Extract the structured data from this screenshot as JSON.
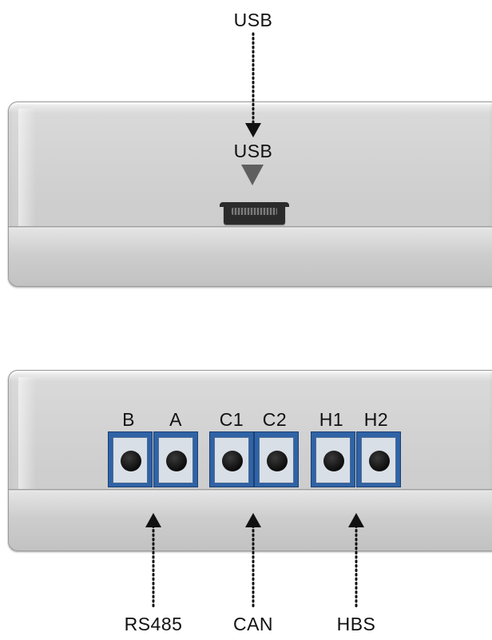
{
  "top_label": "USB",
  "usb_panel": {
    "port_label": "USB"
  },
  "terminal_panel": {
    "terminals": [
      {
        "label": "B"
      },
      {
        "label": "A"
      },
      {
        "label": "C1"
      },
      {
        "label": "C2"
      },
      {
        "label": "H1"
      },
      {
        "label": "H2"
      }
    ],
    "groups": [
      {
        "label": "RS485"
      },
      {
        "label": "CAN"
      },
      {
        "label": "HBS"
      }
    ]
  }
}
